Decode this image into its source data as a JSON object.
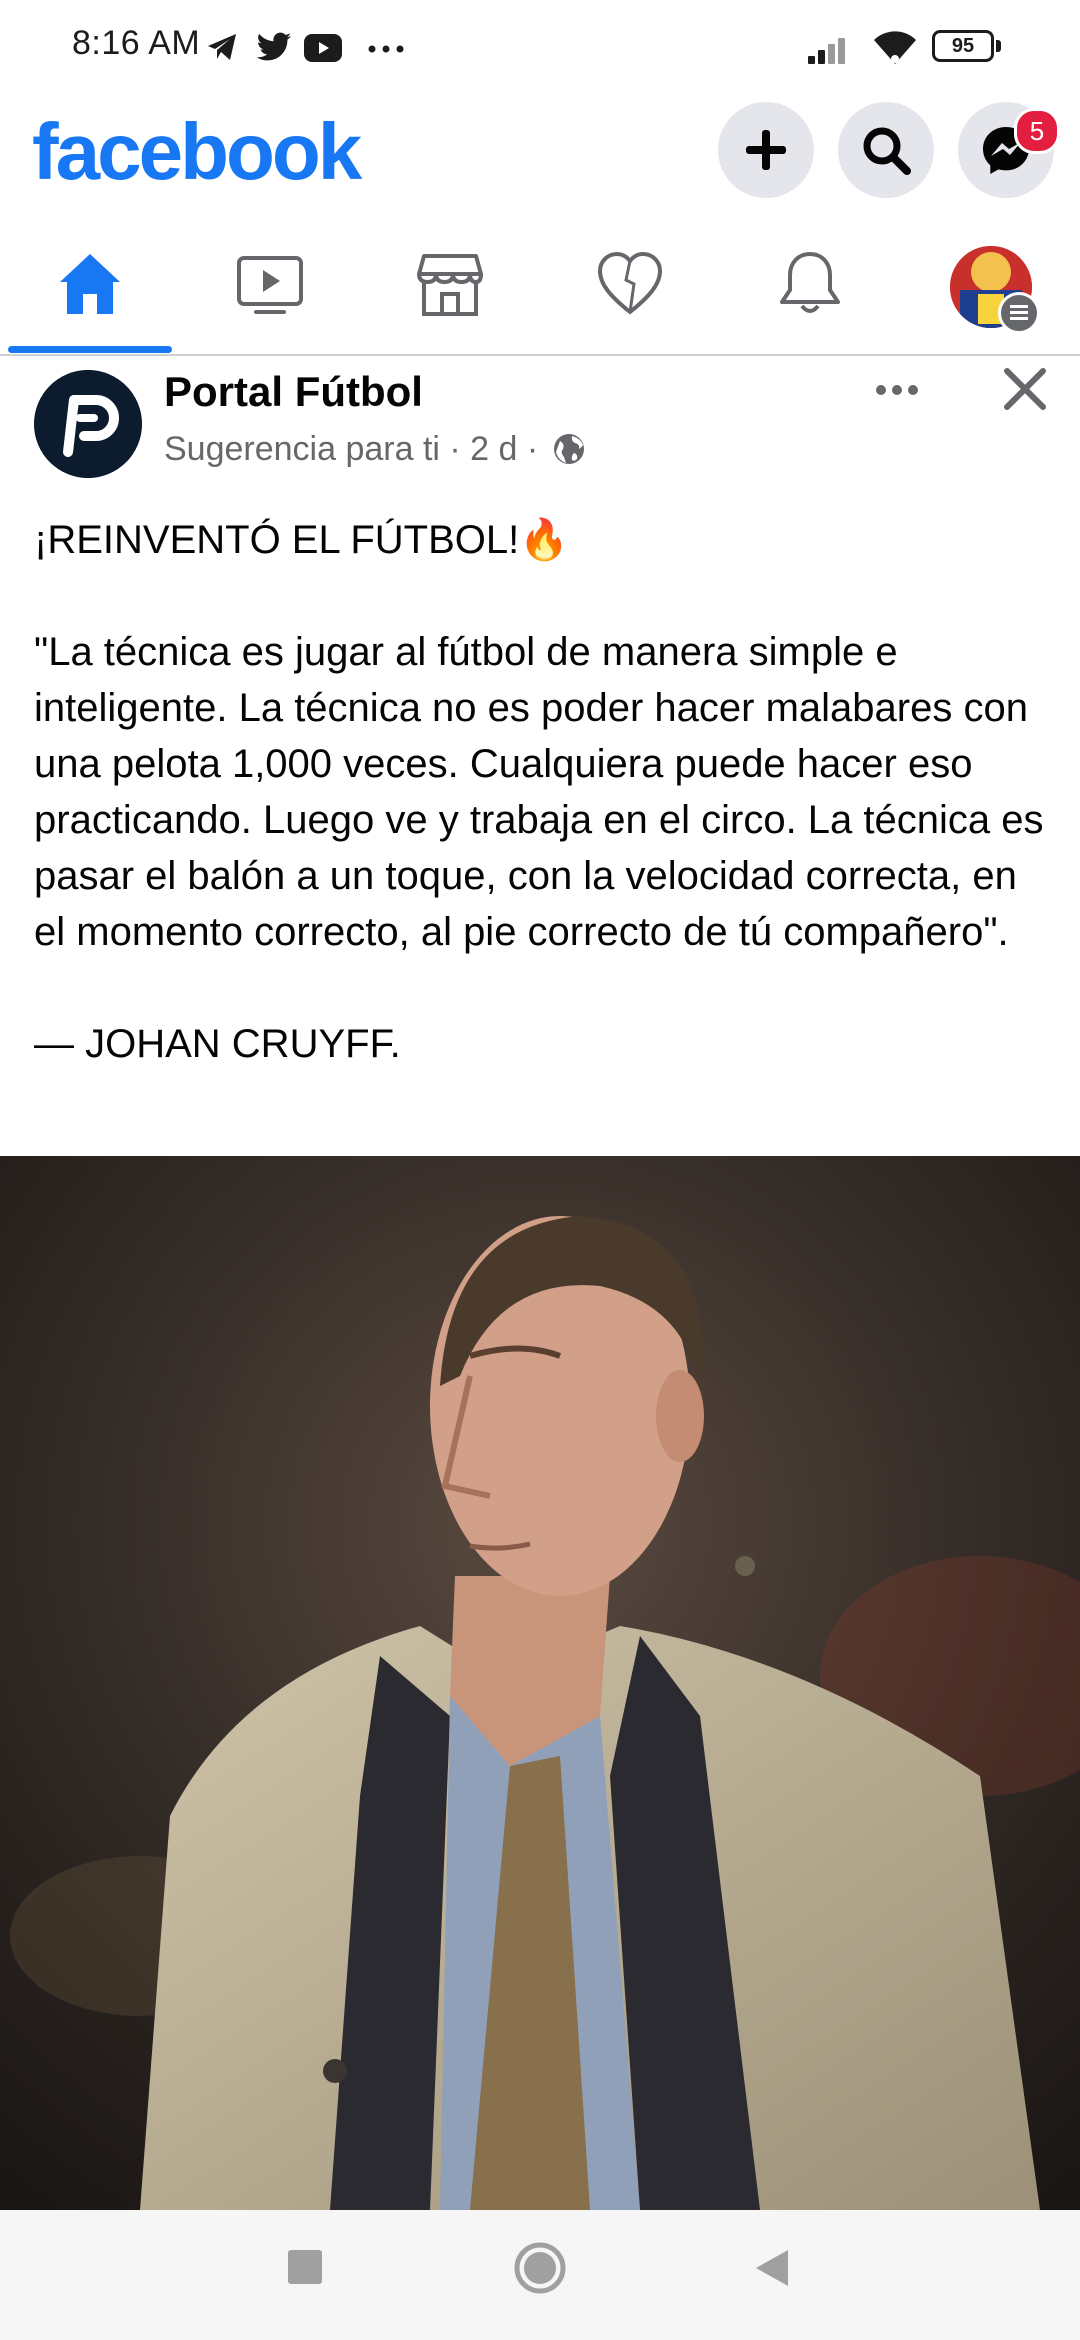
{
  "status_bar": {
    "time": "8:16 AM",
    "icons": [
      "telegram-icon",
      "twitter-icon",
      "youtube-icon",
      "more-notifications-icon"
    ],
    "battery": "95"
  },
  "header": {
    "logo": "facebook",
    "messenger_badge": "5"
  },
  "tabs": [
    "home",
    "watch",
    "marketplace",
    "dating",
    "notifications",
    "profile-menu"
  ],
  "post": {
    "page_name": "Portal Fútbol",
    "meta": "Sugerencia para ti · 2 d ·",
    "headline": "¡REINVENTÓ EL FÚTBOL!🔥",
    "quote": "\"La técnica es jugar al fútbol de manera simple e inteligente. La técnica no es poder hacer malabares con una pelota 1,000 veces. Cualquiera puede hacer eso practicando. Luego ve y trabaja en el circo. La técnica es pasar el balón a un toque, con la velocidad correcta, en el momento correcto, al pie correcto de tú compañero\".",
    "author": "— JOHAN CRUYFF."
  },
  "colors": {
    "brand": "#1877f2",
    "badge": "#e41e3f",
    "secondary_text": "#65676b"
  }
}
